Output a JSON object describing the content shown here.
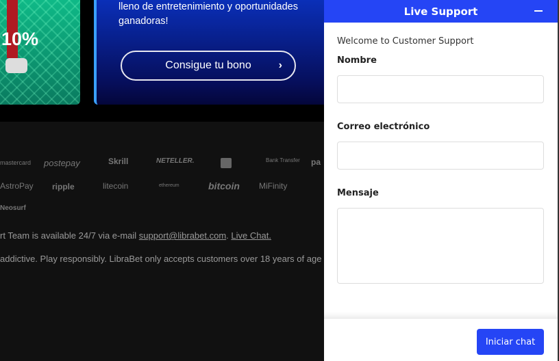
{
  "promos": {
    "bonus_percent": "10%",
    "text": "lleno de entretenimiento y oportunidades ganadoras!",
    "cta_label": "Consigue tu bono",
    "cta_icon": "chevron-right-icon"
  },
  "payments": [
    "mastercard",
    "postepay",
    "Skrill",
    "NETELLER.",
    "Bank Transfer",
    "pa",
    "AstroPay",
    "ripple",
    "litecoin",
    "ethereum",
    "bitcoin",
    "MiFinity",
    "Neosurf"
  ],
  "footer": {
    "support_prefix": "rt Team is available 24/7 via e-mail ",
    "email": "support@librabet.com",
    "sep": ". ",
    "live_chat": "Live Chat.",
    "disclaimer": " addictive. Play responsibly. LibraBet only accepts customers over 18 years of age"
  },
  "support": {
    "title": "Live Support",
    "minimize_icon": "minus-icon",
    "welcome": "Welcome to Customer Support",
    "name_label": "Nombre",
    "email_label": "Correo electrónico",
    "message_label": "Mensaje",
    "start_label": "Iniciar chat",
    "accent": "#2545f5"
  }
}
